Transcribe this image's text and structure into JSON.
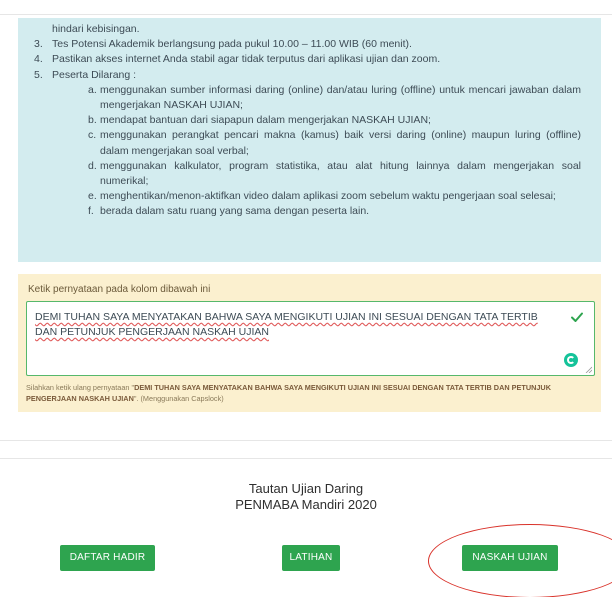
{
  "rules": {
    "line_top": "hindari kebisingan.",
    "items": [
      {
        "num": "3.",
        "text": "Tes Potensi Akademik berlangsung pada pukul 10.00 – 11.00 WIB (60 menit)."
      },
      {
        "num": "4.",
        "text": "Pastikan akses internet Anda stabil agar tidak terputus dari aplikasi ujian dan zoom."
      },
      {
        "num": "5.",
        "text": "Peserta Dilarang :"
      }
    ],
    "prohibitions": [
      {
        "letter": "a.",
        "text": "menggunakan sumber informasi daring (online) dan/atau luring (offline) untuk mencari jawaban dalam mengerjakan NASKAH UJIAN;"
      },
      {
        "letter": "b.",
        "text": "mendapat bantuan dari siapapun dalam mengerjakan NASKAH UJIAN;"
      },
      {
        "letter": "c.",
        "text": "menggunakan perangkat pencari makna (kamus) baik versi daring (online) maupun luring (offline) dalam mengerjakan soal verbal;"
      },
      {
        "letter": "d.",
        "text": "menggunakan kalkulator, program statistika, atau alat hitung lainnya dalam mengerjakan soal numerikal;"
      },
      {
        "letter": "e.",
        "text": "menghentikan/menon-aktifkan video dalam aplikasi zoom sebelum waktu pengerjaan soal selesai;"
      },
      {
        "letter": "f.",
        "text": "berada dalam satu ruang yang sama dengan peserta lain."
      }
    ]
  },
  "statement": {
    "label": "Ketik pernyataan pada kolom dibawah ini",
    "value": "DEMI TUHAN SAYA MENYATAKAN BAHWA SAYA MENGIKUTI UJIAN INI SESUAI DENGAN TATA TERTIB DAN PETUNJUK PENGERJAAN NASKAH UJIAN",
    "hint_prefix": "Silahkan ketik ulang pernyataan \"",
    "hint_bold": "DEMI TUHAN SAYA MENYATAKAN BAHWA SAYA MENGIKUTI UJIAN INI SESUAI DENGAN TATA TERTIB DAN PETUNJUK PENGERJAAN NASKAH UJIAN",
    "hint_suffix": "\". (Menggunakan Capslock)",
    "valid_icon": "check-icon",
    "accent": "#2ea44f"
  },
  "links": {
    "title_line1": "Tautan Ujian Daring",
    "title_line2": "PENMABA Mandiri 2020",
    "buttons": [
      {
        "label": "DAFTAR HADIR"
      },
      {
        "label": "LATIHAN"
      },
      {
        "label": "NASKAH UJIAN"
      }
    ],
    "button_color": "#2ea44f",
    "highlight_color": "#d9322a"
  }
}
